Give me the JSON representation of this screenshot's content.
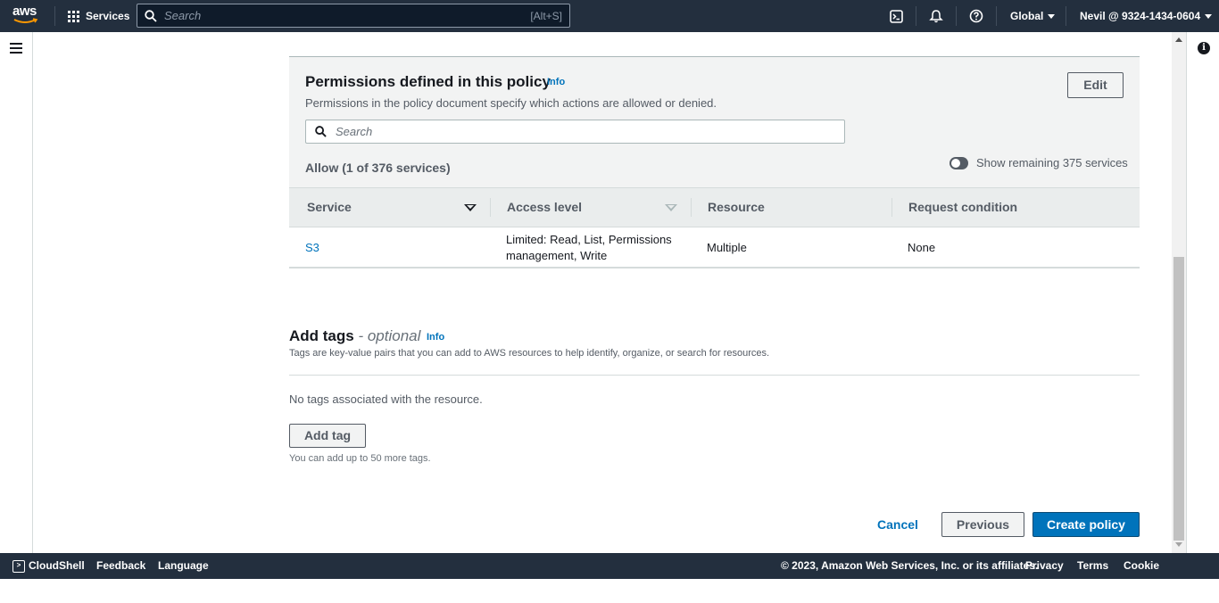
{
  "topnav": {
    "logo": "aws",
    "services_label": "Services",
    "search_placeholder": "Search",
    "search_shortcut": "[Alt+S]",
    "region_label": "Global",
    "account_label": "Nevil @ 9324-1434-0604",
    "icons": [
      "cloudshell-icon",
      "bell-icon",
      "help-icon"
    ]
  },
  "permissions": {
    "title": "Permissions defined in this policy",
    "info": "Info",
    "description": "Permissions in the policy document specify which actions are allowed or denied.",
    "edit_label": "Edit",
    "search_placeholder": "Search",
    "allow_label": "Allow (1 of 376 services)",
    "toggle_label": "Show remaining 375 services",
    "toggle_on": false,
    "columns": [
      "Service",
      "Access level",
      "Resource",
      "Request condition"
    ],
    "rows": [
      {
        "service": "S3",
        "access_level_line1": "Limited: Read, List, Permissions",
        "access_level_line2": "management, Write",
        "resource": "Multiple",
        "request_condition": "None"
      }
    ]
  },
  "tags": {
    "title": "Add tags",
    "optional": "- optional",
    "info": "Info",
    "description": "Tags are key-value pairs that you can add to AWS resources to help identify, organize, or search for resources.",
    "empty_text": "No tags associated with the resource.",
    "add_tag_label": "Add tag",
    "limit_text": "You can add up to 50 more tags."
  },
  "actions": {
    "cancel_label": "Cancel",
    "previous_label": "Previous",
    "create_label": "Create policy"
  },
  "footer": {
    "cloudshell": "CloudShell",
    "feedback": "Feedback",
    "language": "Language",
    "copyright": "© 2023, Amazon Web Services, Inc. or its affiliates.",
    "privacy": "Privacy",
    "terms": "Terms",
    "cookies": "Cookie preferences"
  },
  "colors": {
    "nav_bg": "#232f3e",
    "link": "#0073bb",
    "primary_button": "#0073bb",
    "panel_bg": "#f2f3f3"
  }
}
